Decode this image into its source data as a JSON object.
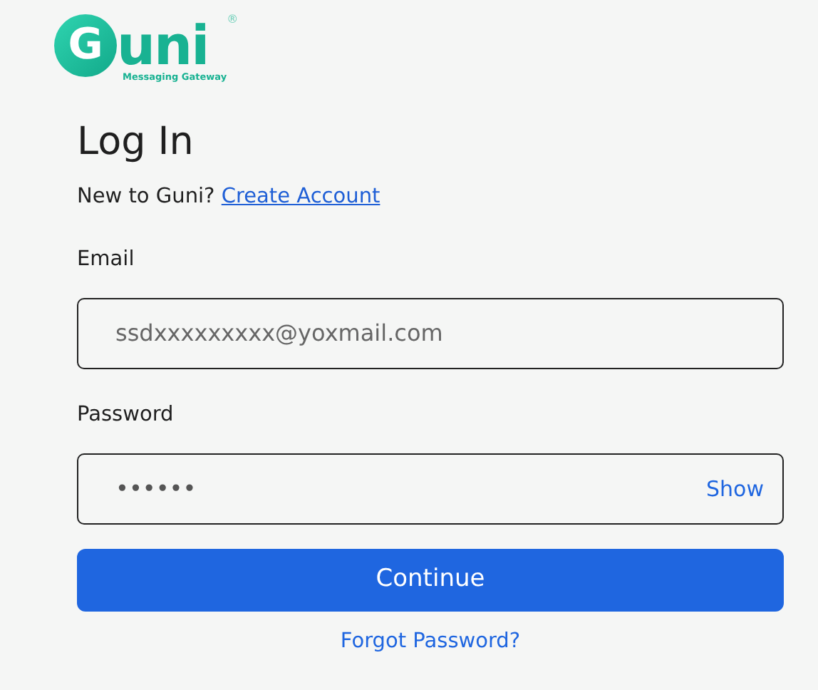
{
  "logo": {
    "letter": "G",
    "name": "uni",
    "mark": "®",
    "tagline": "Messaging Gateway"
  },
  "title": "Log In",
  "signup": {
    "prompt": "New to Guni?",
    "link": "Create Account"
  },
  "email": {
    "label": "Email",
    "placeholder": "ssdxxxxxxxxx@yoxmail.com"
  },
  "password": {
    "label": "Password",
    "value": "••••••",
    "toggle": "Show"
  },
  "submit": "Continue",
  "forgot": "Forgot Password?"
}
